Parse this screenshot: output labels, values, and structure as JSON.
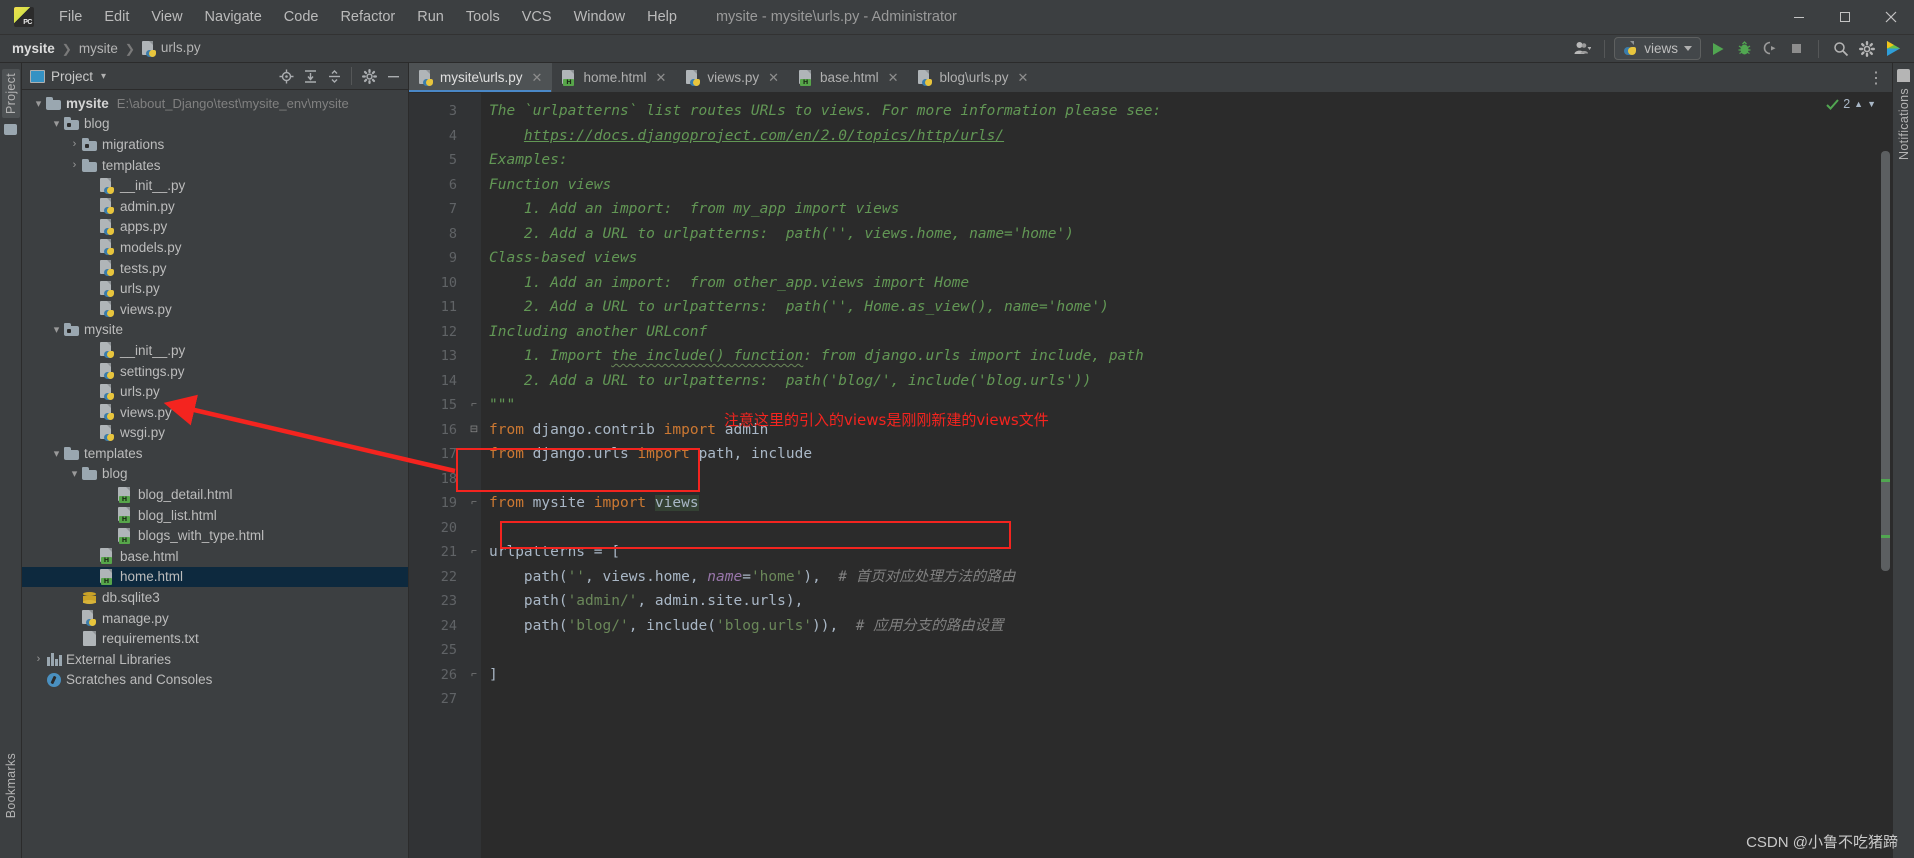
{
  "window": {
    "title": "mysite - mysite\\urls.py - Administrator",
    "minimize": "—",
    "maximize": "▢",
    "close": "✕"
  },
  "menu": {
    "items": [
      {
        "label": "File"
      },
      {
        "label": "Edit"
      },
      {
        "label": "View"
      },
      {
        "label": "Navigate"
      },
      {
        "label": "Code"
      },
      {
        "label": "Refactor"
      },
      {
        "label": "Run"
      },
      {
        "label": "Tools"
      },
      {
        "label": "VCS"
      },
      {
        "label": "Window"
      },
      {
        "label": "Help"
      }
    ]
  },
  "breadcrumb": {
    "sep": "❯",
    "items": [
      {
        "label": "mysite",
        "icon": "none"
      },
      {
        "label": "mysite",
        "icon": "none"
      },
      {
        "label": "urls.py",
        "icon": "python-file-icon"
      }
    ]
  },
  "toolbar": {
    "user_icon": "user-icon",
    "run_config": {
      "label": "views",
      "icon": "python-icon"
    },
    "run_icon": "run-icon",
    "debug_icon": "debug-icon",
    "coverage_icon": "run-with-coverage-icon",
    "stop_icon": "stop-icon",
    "search_icon": "search-everywhere-icon",
    "settings_icon": "settings-icon",
    "plugin_icon": "ide-features-icon"
  },
  "left_rail": {
    "project_tab": "Project",
    "bookmarks_tab": "Bookmarks"
  },
  "right_rail": {
    "notifications_tab": "Notifications"
  },
  "project_panel": {
    "title": "Project",
    "caret": "▾",
    "icons": [
      "locate-icon",
      "expand-all-icon",
      "collapse-all-icon",
      "settings-icon",
      "hide-icon"
    ],
    "tree": [
      {
        "depth": 0,
        "arrow": "▾",
        "icon": "folder-icon",
        "label": "mysite",
        "bold": true,
        "path": "E:\\about_Django\\test\\mysite_env\\mysite",
        "selected": false
      },
      {
        "depth": 1,
        "arrow": "▾",
        "icon": "module-folder-icon",
        "label": "blog",
        "bold": false,
        "path": "",
        "selected": false
      },
      {
        "depth": 2,
        "arrow": "›",
        "icon": "module-folder-icon",
        "label": "migrations",
        "bold": false,
        "path": "",
        "selected": false
      },
      {
        "depth": 2,
        "arrow": "›",
        "icon": "folder-icon",
        "label": "templates",
        "bold": false,
        "path": "",
        "selected": false
      },
      {
        "depth": 3,
        "arrow": "",
        "icon": "python-file-icon",
        "label": "__init__.py",
        "bold": false,
        "path": "",
        "selected": false
      },
      {
        "depth": 3,
        "arrow": "",
        "icon": "python-file-icon",
        "label": "admin.py",
        "bold": false,
        "path": "",
        "selected": false
      },
      {
        "depth": 3,
        "arrow": "",
        "icon": "python-file-icon",
        "label": "apps.py",
        "bold": false,
        "path": "",
        "selected": false
      },
      {
        "depth": 3,
        "arrow": "",
        "icon": "python-file-icon",
        "label": "models.py",
        "bold": false,
        "path": "",
        "selected": false
      },
      {
        "depth": 3,
        "arrow": "",
        "icon": "python-file-icon",
        "label": "tests.py",
        "bold": false,
        "path": "",
        "selected": false
      },
      {
        "depth": 3,
        "arrow": "",
        "icon": "python-file-icon",
        "label": "urls.py",
        "bold": false,
        "path": "",
        "selected": false
      },
      {
        "depth": 3,
        "arrow": "",
        "icon": "python-file-icon",
        "label": "views.py",
        "bold": false,
        "path": "",
        "selected": false
      },
      {
        "depth": 1,
        "arrow": "▾",
        "icon": "module-folder-icon",
        "label": "mysite",
        "bold": false,
        "path": "",
        "selected": false
      },
      {
        "depth": 3,
        "arrow": "",
        "icon": "python-file-icon",
        "label": "__init__.py",
        "bold": false,
        "path": "",
        "selected": false
      },
      {
        "depth": 3,
        "arrow": "",
        "icon": "python-file-icon",
        "label": "settings.py",
        "bold": false,
        "path": "",
        "selected": false
      },
      {
        "depth": 3,
        "arrow": "",
        "icon": "python-file-icon",
        "label": "urls.py",
        "bold": false,
        "path": "",
        "selected": false
      },
      {
        "depth": 3,
        "arrow": "",
        "icon": "python-file-icon",
        "label": "views.py",
        "bold": false,
        "path": "",
        "selected": false
      },
      {
        "depth": 3,
        "arrow": "",
        "icon": "python-file-icon",
        "label": "wsgi.py",
        "bold": false,
        "path": "",
        "selected": false
      },
      {
        "depth": 1,
        "arrow": "▾",
        "icon": "folder-icon",
        "label": "templates",
        "bold": false,
        "path": "",
        "selected": false
      },
      {
        "depth": 2,
        "arrow": "▾",
        "icon": "folder-icon",
        "label": "blog",
        "bold": false,
        "path": "",
        "selected": false
      },
      {
        "depth": 4,
        "arrow": "",
        "icon": "html-file-icon",
        "label": "blog_detail.html",
        "bold": false,
        "path": "",
        "selected": false
      },
      {
        "depth": 4,
        "arrow": "",
        "icon": "html-file-icon",
        "label": "blog_list.html",
        "bold": false,
        "path": "",
        "selected": false
      },
      {
        "depth": 4,
        "arrow": "",
        "icon": "html-file-icon",
        "label": "blogs_with_type.html",
        "bold": false,
        "path": "",
        "selected": false
      },
      {
        "depth": 3,
        "arrow": "",
        "icon": "html-file-icon",
        "label": "base.html",
        "bold": false,
        "path": "",
        "selected": false
      },
      {
        "depth": 3,
        "arrow": "",
        "icon": "html-file-icon",
        "label": "home.html",
        "bold": false,
        "path": "",
        "selected": true
      },
      {
        "depth": 2,
        "arrow": "",
        "icon": "sqlite-file-icon",
        "label": "db.sqlite3",
        "bold": false,
        "path": "",
        "selected": false
      },
      {
        "depth": 2,
        "arrow": "",
        "icon": "python-file-icon",
        "label": "manage.py",
        "bold": false,
        "path": "",
        "selected": false
      },
      {
        "depth": 2,
        "arrow": "",
        "icon": "text-file-icon",
        "label": "requirements.txt",
        "bold": false,
        "path": "",
        "selected": false
      },
      {
        "depth": 0,
        "arrow": "›",
        "icon": "library-icon",
        "label": "External Libraries",
        "bold": false,
        "path": "",
        "selected": false
      },
      {
        "depth": 0,
        "arrow": "",
        "icon": "scratches-icon",
        "label": "Scratches and Consoles",
        "bold": false,
        "path": "",
        "selected": false
      }
    ]
  },
  "editor": {
    "tabs": [
      {
        "label": "mysite\\urls.py",
        "icon": "python-file-icon",
        "active": true,
        "close": "✕"
      },
      {
        "label": "home.html",
        "icon": "html-file-icon",
        "active": false,
        "close": "✕"
      },
      {
        "label": "views.py",
        "icon": "python-file-icon",
        "active": false,
        "close": "✕"
      },
      {
        "label": "base.html",
        "icon": "html-file-icon",
        "active": false,
        "close": "✕"
      },
      {
        "label": "blog\\urls.py",
        "icon": "python-file-icon",
        "active": false,
        "close": "✕"
      }
    ],
    "tabs_overflow_icon": "more-options-icon",
    "inspection": {
      "count": "2",
      "status_icon": "inspections-ok-icon",
      "up_icon": "▲",
      "down_icon": "▼"
    },
    "line_numbers": [
      "3",
      "4",
      "5",
      "6",
      "7",
      "8",
      "9",
      "10",
      "11",
      "12",
      "13",
      "14",
      "15",
      "16",
      "17",
      "18",
      "19",
      "20",
      "21",
      "22",
      "23",
      "24",
      "25",
      "26",
      "27"
    ],
    "lines": [
      {
        "n": "3",
        "text": "The `urlpatterns` list routes URLs to views. For more information please see:"
      },
      {
        "n": "4",
        "text": "    https://docs.djangoproject.com/en/2.0/topics/http/urls/"
      },
      {
        "n": "5",
        "text": "Examples:"
      },
      {
        "n": "6",
        "text": "Function views"
      },
      {
        "n": "7",
        "text": "    1. Add an import:  from my_app import views"
      },
      {
        "n": "8",
        "text": "    2. Add a URL to urlpatterns:  path('', views.home, name='home')"
      },
      {
        "n": "9",
        "text": "Class-based views"
      },
      {
        "n": "10",
        "text": "    1. Add an import:  from other_app.views import Home"
      },
      {
        "n": "11",
        "text": "    2. Add a URL to urlpatterns:  path('', Home.as_view(), name='home')"
      },
      {
        "n": "12",
        "text": "Including another URLconf"
      },
      {
        "n": "13",
        "text": "    1. Import the include() function: from django.urls import include, path"
      },
      {
        "n": "14",
        "text": "    2. Add a URL to urlpatterns:  path('blog/', include('blog.urls'))"
      },
      {
        "n": "15",
        "text": "\"\"\""
      },
      {
        "n": "16",
        "text": "from django.contrib import admin"
      },
      {
        "n": "17",
        "text": "from django.urls import path, include"
      },
      {
        "n": "18",
        "text": ""
      },
      {
        "n": "19",
        "text": "from mysite import views"
      },
      {
        "n": "20",
        "text": ""
      },
      {
        "n": "21",
        "text": "urlpatterns = ["
      },
      {
        "n": "22",
        "text": "    path('', views.home, name='home'),  # 首页对应处理方法的路由"
      },
      {
        "n": "23",
        "text": "    path('admin/', admin.site.urls),"
      },
      {
        "n": "24",
        "text": "    path('blog/', include('blog.urls')),  # 应用分支的路由设置"
      },
      {
        "n": "25",
        "text": ""
      },
      {
        "n": "26",
        "text": "]"
      },
      {
        "n": "27",
        "text": ""
      }
    ]
  },
  "annotations": {
    "note_text": "注意这里的引入的views是刚刚新建的views文件",
    "note_color": "#f4241f",
    "box1_target": "from mysite import views",
    "box2_target": "path('', views.home, name='home'),  # 首页对应处理方法的路由",
    "arrow_from": "from mysite import views",
    "arrow_to": "views.py"
  },
  "watermark": "CSDN @小鲁不吃猪蹄"
}
